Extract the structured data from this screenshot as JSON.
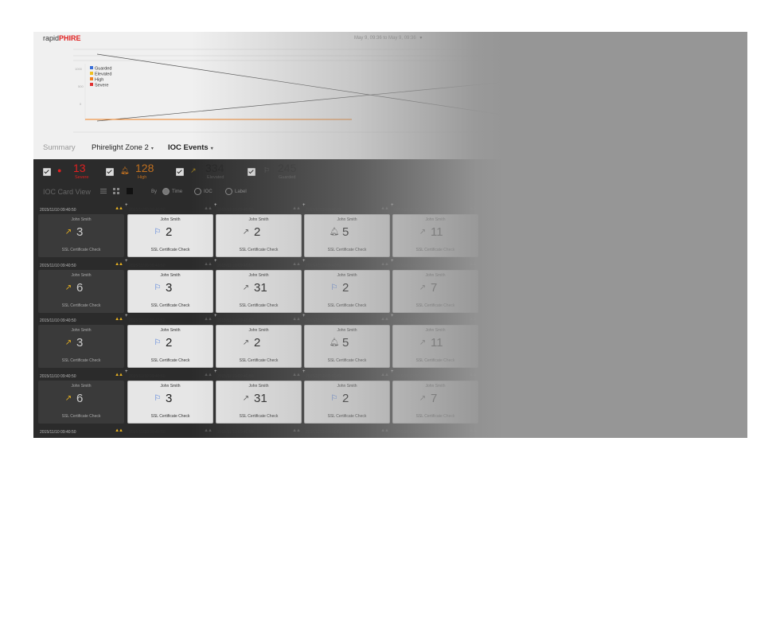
{
  "app": {
    "brand_prefix": "rapid",
    "brand_suffix": "PHIRE",
    "date_range": "May 9, 09:36 to May 9, 09:36"
  },
  "chart_data": {
    "type": "line",
    "legend": [
      "Guarded",
      "Elevated",
      "High",
      "Severe"
    ],
    "colors": {
      "Guarded": "#3a6fd8",
      "Elevated": "#f0c020",
      "High": "#f08020",
      "Severe": "#e03030"
    },
    "ytick_labels": [
      "1000",
      "500",
      "0"
    ],
    "legend_position": "top-left"
  },
  "nav": {
    "summary": "Summary",
    "zone": "Phirelight  Zone 2",
    "ioc_events": "IOC Events"
  },
  "filters": [
    {
      "count": "13",
      "label": "Severe",
      "color": "#e02020",
      "icon": "alert-circle-icon"
    },
    {
      "count": "128",
      "label": "High",
      "color": "#e08020",
      "icon": "bell-icon"
    },
    {
      "count": "334",
      "label": "Elevated",
      "color": "#222222",
      "icon": "arrow-up-right-icon"
    },
    {
      "count": "245",
      "label": "Guarded",
      "color": "#222222",
      "icon": "flag-icon"
    }
  ],
  "toolbar": {
    "title": "IOC Card View",
    "by": "By",
    "options": [
      "Time",
      "IOC",
      "Label"
    ]
  },
  "cards": {
    "timestamp": "2015/11/10   09:40:50",
    "user": "John Smith",
    "check": "SSL Certificate Check",
    "rows": [
      [
        {
          "sev": "arrow-up-right-icon",
          "count": "3"
        },
        {
          "sev": "flag-icon",
          "count": "2"
        },
        {
          "sev": "arrow-up-right-icon",
          "count": "2"
        },
        {
          "sev": "bell-icon",
          "count": "5"
        },
        {
          "sev": "arrow-up-right-icon",
          "count": "11"
        }
      ],
      [
        {
          "sev": "arrow-up-right-icon",
          "count": "6"
        },
        {
          "sev": "flag-icon",
          "count": "3"
        },
        {
          "sev": "arrow-up-right-icon",
          "count": "31"
        },
        {
          "sev": "flag-icon",
          "count": "2"
        },
        {
          "sev": "arrow-up-right-icon",
          "count": "7"
        }
      ],
      [
        {
          "sev": "arrow-up-right-icon",
          "count": "3"
        },
        {
          "sev": "flag-icon",
          "count": "2"
        },
        {
          "sev": "arrow-up-right-icon",
          "count": "2"
        },
        {
          "sev": "bell-icon",
          "count": "5"
        },
        {
          "sev": "arrow-up-right-icon",
          "count": "11"
        }
      ],
      [
        {
          "sev": "arrow-up-right-icon",
          "count": "6"
        },
        {
          "sev": "flag-icon",
          "count": "3"
        },
        {
          "sev": "arrow-up-right-icon",
          "count": "31"
        },
        {
          "sev": "flag-icon",
          "count": "2"
        },
        {
          "sev": "arrow-up-right-icon",
          "count": "7"
        }
      ],
      [
        {
          "sev": "",
          "count": ""
        },
        {
          "sev": "",
          "count": ""
        },
        {
          "sev": "",
          "count": ""
        },
        {
          "sev": "",
          "count": ""
        },
        {
          "sev": "",
          "count": ""
        }
      ]
    ]
  }
}
